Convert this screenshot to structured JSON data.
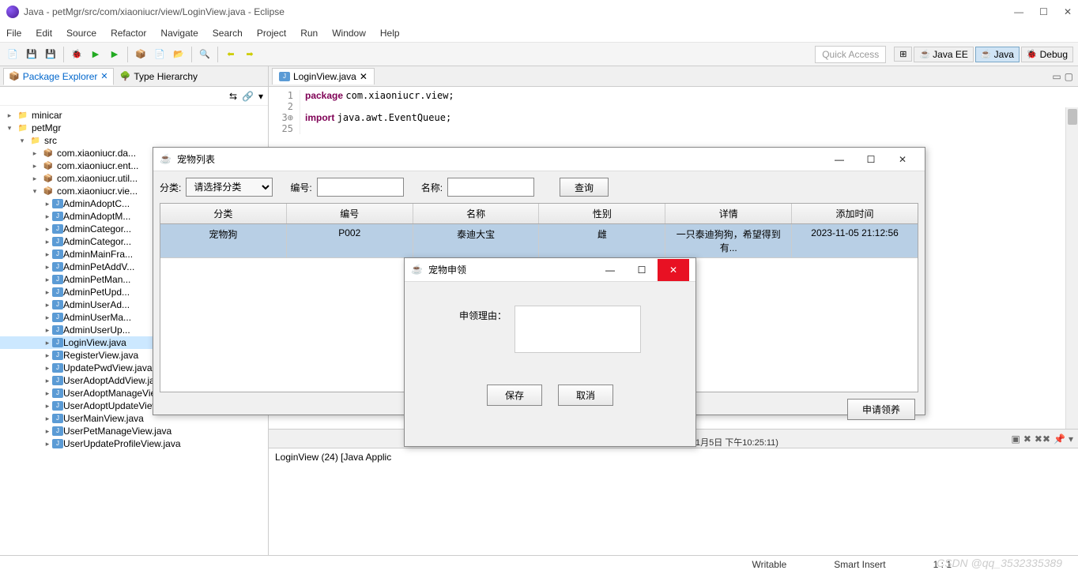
{
  "window": {
    "title": "Java - petMgr/src/com/xiaoniucr/view/LoginView.java - Eclipse"
  },
  "menu": [
    "File",
    "Edit",
    "Source",
    "Refactor",
    "Navigate",
    "Search",
    "Project",
    "Run",
    "Window",
    "Help"
  ],
  "quick_access": "Quick Access",
  "perspectives": {
    "javaee": "Java EE",
    "java": "Java",
    "debug": "Debug"
  },
  "sidebar": {
    "tabs": {
      "pkg": "Package Explorer",
      "type": "Type Hierarchy"
    },
    "projects": {
      "p1": "minicar",
      "p2": "petMgr",
      "src": "src"
    },
    "packages": [
      "com.xiaoniucr.da...",
      "com.xiaoniucr.ent...",
      "com.xiaoniucr.util...",
      "com.xiaoniucr.vie..."
    ],
    "files": [
      "AdminAdoptC...",
      "AdminAdoptM...",
      "AdminCategor...",
      "AdminCategor...",
      "AdminMainFra...",
      "AdminPetAddV...",
      "AdminPetMan...",
      "AdminPetUpd...",
      "AdminUserAd...",
      "AdminUserMa...",
      "AdminUserUp...",
      "LoginView.java",
      "RegisterView.java",
      "UpdatePwdView.java",
      "UserAdoptAddView.java",
      "UserAdoptManageView.java",
      "UserAdoptUpdateView.java",
      "UserMainView.java",
      "UserPetManageView.java",
      "UserUpdateProfileView.java"
    ]
  },
  "editor": {
    "tab": "LoginView.java",
    "lines": [
      {
        "n": "1",
        "pre": "package ",
        "code": "com.xiaoniucr.view;"
      },
      {
        "n": "2",
        "pre": "",
        "code": ""
      },
      {
        "n": "3⊕",
        "pre": "import ",
        "code": "java.awt.EventQueue;"
      },
      {
        "n": "25",
        "pre": "",
        "code": ""
      }
    ]
  },
  "console": {
    "text": "LoginView (24) [Java Applic",
    "suffix": "1月5日 下午10:25:11)"
  },
  "statusbar": {
    "writable": "Writable",
    "insert": "Smart Insert",
    "pos": "1 : 1"
  },
  "petlist": {
    "title": "宠物列表",
    "labels": {
      "cat": "分类:",
      "catph": "请选择分类",
      "id": "编号:",
      "name": "名称:",
      "search": "查询",
      "apply": "申请领养"
    },
    "headers": [
      "分类",
      "编号",
      "名称",
      "性别",
      "详情",
      "添加时间"
    ],
    "row": [
      "宠物狗",
      "P002",
      "泰迪大宝",
      "雌",
      "一只泰迪狗狗，希望得到有...",
      "2023-11-05 21:12:56"
    ]
  },
  "claim": {
    "title": "宠物申领",
    "reason_label": "申领理由：",
    "save": "保存",
    "cancel": "取消"
  },
  "watermark": "CSDN @qq_3532335389"
}
